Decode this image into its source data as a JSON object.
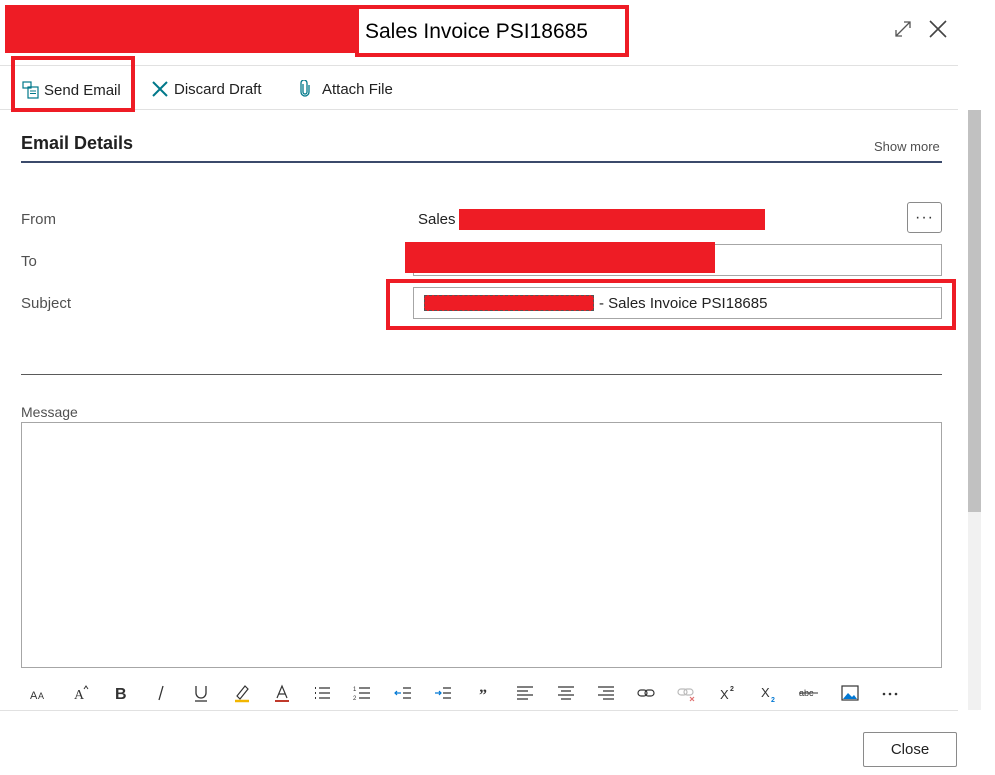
{
  "header": {
    "title": "Sales Invoice PSI18685"
  },
  "toolbar": {
    "send_label": "Send Email",
    "discard_label": "Discard Draft",
    "attach_label": "Attach File"
  },
  "section": {
    "title": "Email Details",
    "show_more": "Show more"
  },
  "fields": {
    "from_label": "From",
    "from_value": "Sales",
    "to_label": "To",
    "subject_label": "Subject",
    "subject_suffix": "- Sales Invoice PSI18685"
  },
  "message": {
    "label": "Message"
  },
  "format_toolbar": {
    "icons": [
      "font-size-icon",
      "font-style-icon",
      "bold-icon",
      "italic-icon",
      "underline-icon",
      "highlight-icon",
      "font-color-icon",
      "bullet-list-icon",
      "numbered-list-icon",
      "decrease-indent-icon",
      "increase-indent-icon",
      "quote-icon",
      "align-left-icon",
      "align-center-icon",
      "align-right-icon",
      "link-icon",
      "unlink-icon",
      "superscript-icon",
      "subscript-icon",
      "strikethrough-icon",
      "image-icon",
      "more-icon"
    ]
  },
  "footer": {
    "close_label": "Close"
  },
  "colors": {
    "accent": "#00788a",
    "redaction": "#ee1c25",
    "section_line": "#3b4a6b"
  }
}
